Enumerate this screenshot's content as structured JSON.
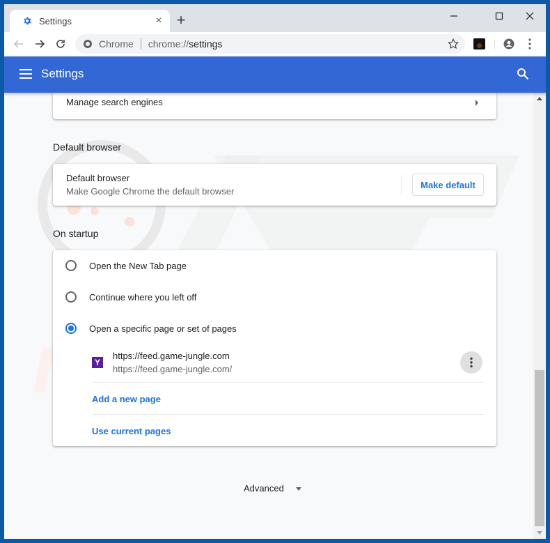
{
  "browser": {
    "tab": {
      "title": "Settings",
      "icon": "gear-icon"
    },
    "new_tab_label": "+",
    "window_controls": {
      "minimize": "—",
      "maximize": "☐",
      "close": "✕"
    },
    "omnibox": {
      "chip_label": "Chrome",
      "url_prefix": "chrome://",
      "url_path": "settings"
    }
  },
  "appbar": {
    "title": "Settings"
  },
  "search_engine_card": {
    "manage_label": "Manage search engines"
  },
  "default_browser": {
    "section_title": "Default browser",
    "title": "Default browser",
    "subtitle": "Make Google Chrome the default browser",
    "button_label": "Make default"
  },
  "on_startup": {
    "section_title": "On startup",
    "options": [
      {
        "label": "Open the New Tab page",
        "checked": false
      },
      {
        "label": "Continue where you left off",
        "checked": false
      },
      {
        "label": "Open a specific page or set of pages",
        "checked": true
      }
    ],
    "pages": [
      {
        "favicon": "Y",
        "title": "https://feed.game-jungle.com",
        "url": "https://feed.game-jungle.com/"
      }
    ],
    "add_page_label": "Add a new page",
    "use_current_label": "Use current pages"
  },
  "advanced": {
    "label": "Advanced"
  },
  "colors": {
    "accent": "#1a73e8",
    "appbar": "#3367d6",
    "favicon_bg": "#5a1ea0"
  }
}
